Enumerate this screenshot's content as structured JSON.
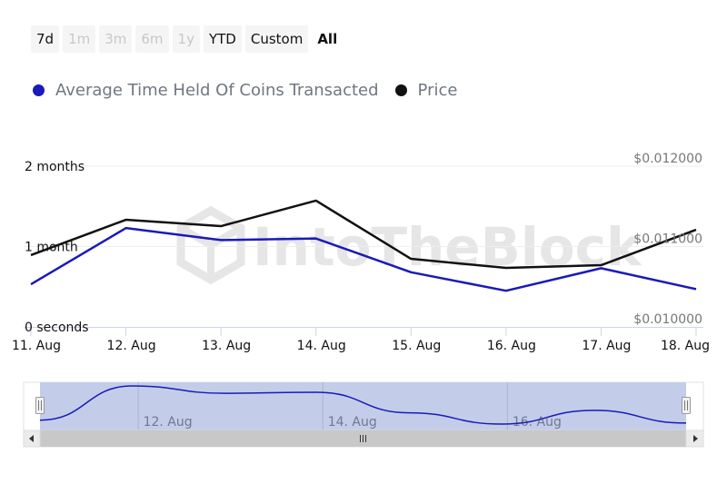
{
  "range_selector": {
    "buttons": [
      {
        "label": "7d",
        "state": "enabled"
      },
      {
        "label": "1m",
        "state": "disabled"
      },
      {
        "label": "3m",
        "state": "disabled"
      },
      {
        "label": "6m",
        "state": "disabled"
      },
      {
        "label": "1y",
        "state": "disabled"
      },
      {
        "label": "YTD",
        "state": "enabled"
      },
      {
        "label": "Custom",
        "state": "enabled"
      },
      {
        "label": "All",
        "state": "active"
      }
    ]
  },
  "watermark": "IntoTheBlock",
  "chart_data": {
    "type": "line",
    "title": "",
    "x": [
      "11. Aug",
      "12. Aug",
      "13. Aug",
      "14. Aug",
      "15. Aug",
      "16. Aug",
      "17. Aug",
      "18. Aug"
    ],
    "series": [
      {
        "name": "Average Time Held Of Coins Transacted",
        "color": "#1a1ab8",
        "axis": "left",
        "unit": "months",
        "values": [
          0.53,
          1.23,
          1.08,
          1.1,
          0.68,
          0.45,
          0.73,
          0.47
        ]
      },
      {
        "name": "Price",
        "color": "#111111",
        "axis": "right",
        "unit": "USD",
        "values": [
          0.010893,
          0.011333,
          0.011254,
          0.011571,
          0.010847,
          0.010734,
          0.010768,
          0.011209
        ]
      }
    ],
    "left_axis": {
      "range": [
        0,
        2
      ],
      "ticks": [
        0,
        1,
        2
      ],
      "tick_labels": [
        "0 seconds",
        "1 month",
        "2 months"
      ]
    },
    "right_axis": {
      "range": [
        0.01,
        0.012
      ],
      "ticks": [
        0.01,
        0.011,
        0.012
      ],
      "tick_labels": [
        "$0.010000",
        "$0.011000",
        "$0.012000"
      ]
    },
    "grid": true,
    "legend_position": "top-left",
    "navigator": {
      "tick_labels": [
        "12. Aug",
        "14. Aug",
        "16. Aug"
      ],
      "selected_range": [
        "11. Aug",
        "18. Aug"
      ]
    }
  }
}
